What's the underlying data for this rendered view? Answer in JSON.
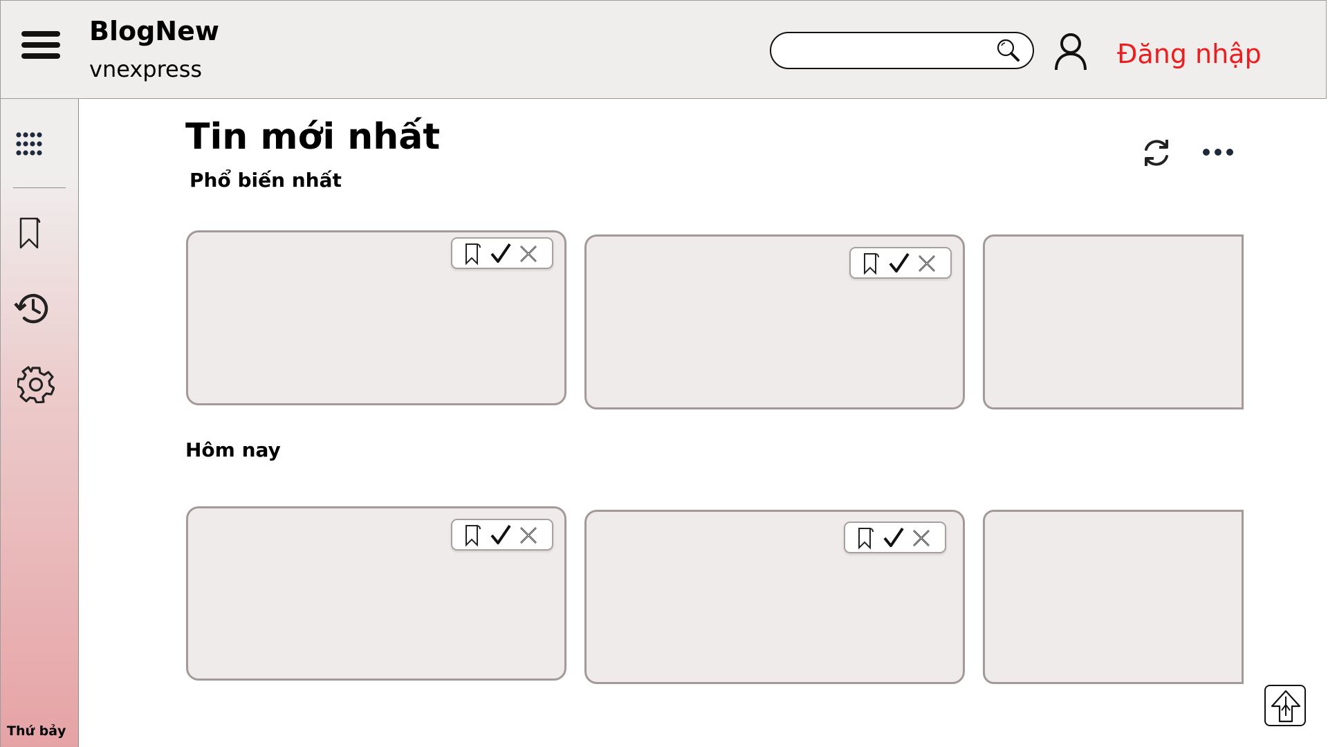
{
  "header": {
    "brand_title": "BlogNew",
    "brand_subtitle": "vnexpress",
    "search_placeholder": "",
    "login_label": "Đăng nhập",
    "login_color": "#ee1c1c"
  },
  "sidebar": {
    "icons": [
      "apps-grid-icon",
      "bookmark-icon",
      "history-icon",
      "settings-icon"
    ],
    "day_label": "Thứ bảy"
  },
  "main": {
    "title": "Tin mới nhất",
    "sections": [
      {
        "heading": "Phổ biến nhất"
      },
      {
        "heading": "Hôm nay"
      }
    ]
  }
}
